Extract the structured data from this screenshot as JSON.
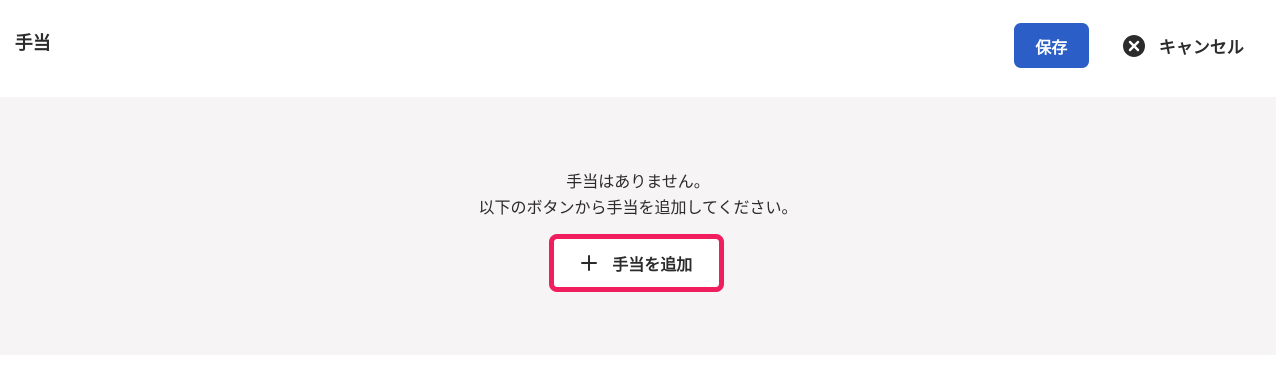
{
  "header": {
    "title": "手当",
    "save_label": "保存",
    "cancel_label": "キャンセル",
    "cancel_icon": "close-circle-icon"
  },
  "empty_state": {
    "line1": "手当はありません。",
    "line2": "以下のボタンから手当を追加してください。",
    "add_label": "手当を追加",
    "add_icon": "plus-icon"
  },
  "colors": {
    "primary": "#2b5fc7",
    "highlight": "#f01e5f",
    "panel_background": "#f6f4f4",
    "text": "#2b2b2b"
  }
}
